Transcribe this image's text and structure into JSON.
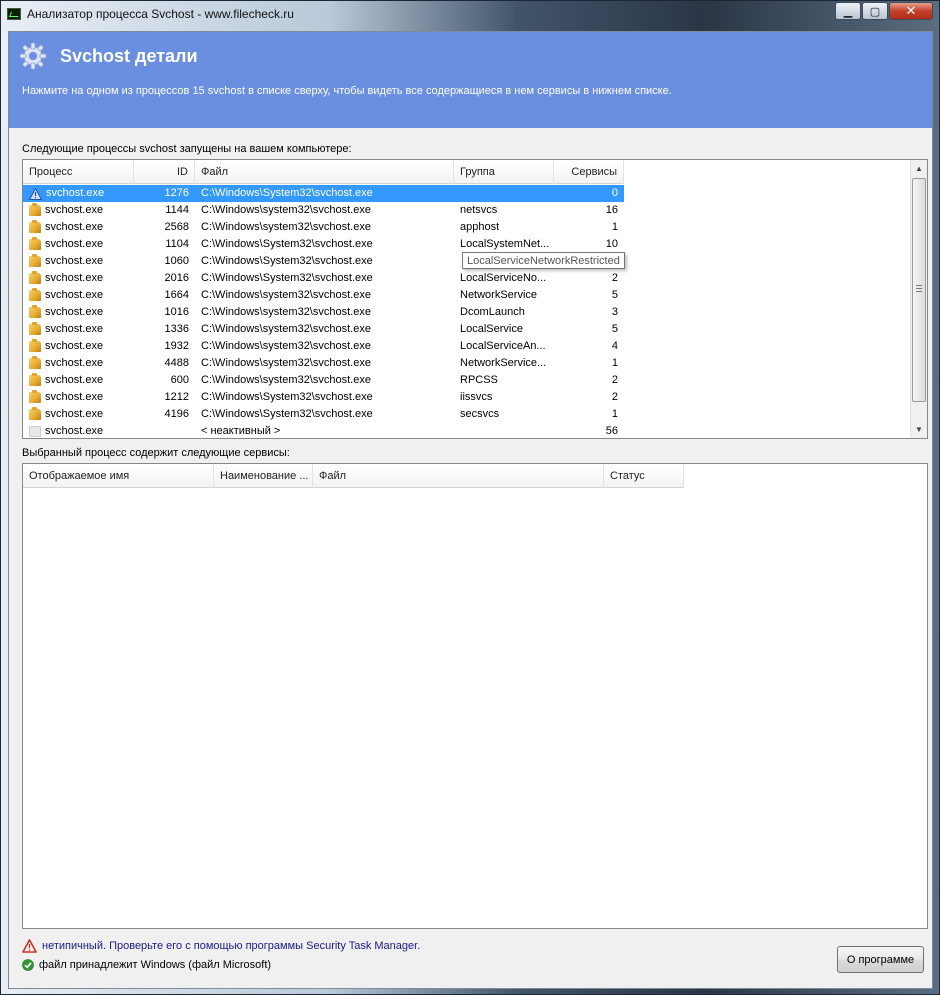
{
  "window": {
    "title": "Анализатор процесса Svchost - www.filecheck.ru",
    "minimize_glyph": "▁",
    "maximize_glyph": "▢",
    "close_glyph": "✕"
  },
  "banner": {
    "title": "Svchost детали",
    "subtitle": "Нажмите на одном из процессов 15 svchost в списке сверху, чтобы видеть все содержащиеся в нем сервисы в нижнем списке.",
    "icon": "gear-icon"
  },
  "processes_section": {
    "label": "Следующие процессы svchost запущены на вашем компьютере:",
    "columns": [
      "Процесс",
      "ID",
      "Файл",
      "Группа",
      "Сервисы"
    ],
    "rows": [
      {
        "process": "svchost.exe",
        "id": "1276",
        "file": "C:\\Windows\\System32\\svchost.exe",
        "group": "",
        "services": "0",
        "icon": "warning-icon",
        "selected": true
      },
      {
        "process": "svchost.exe",
        "id": "1144",
        "file": "C:\\Windows\\system32\\svchost.exe",
        "group": "netsvcs",
        "services": "16",
        "icon": "folder-icon"
      },
      {
        "process": "svchost.exe",
        "id": "2568",
        "file": "C:\\Windows\\system32\\svchost.exe",
        "group": "apphost",
        "services": "1",
        "icon": "folder-icon"
      },
      {
        "process": "svchost.exe",
        "id": "1104",
        "file": "C:\\Windows\\System32\\svchost.exe",
        "group": "LocalSystemNet...",
        "services": "10",
        "icon": "folder-icon"
      },
      {
        "process": "svchost.exe",
        "id": "1060",
        "file": "C:\\Windows\\System32\\svchost.exe",
        "group": "",
        "services": "",
        "icon": "folder-icon"
      },
      {
        "process": "svchost.exe",
        "id": "2016",
        "file": "C:\\Windows\\System32\\svchost.exe",
        "group": "LocalServiceNo...",
        "services": "2",
        "icon": "folder-icon"
      },
      {
        "process": "svchost.exe",
        "id": "1664",
        "file": "C:\\Windows\\system32\\svchost.exe",
        "group": "NetworkService",
        "services": "5",
        "icon": "folder-icon"
      },
      {
        "process": "svchost.exe",
        "id": "1016",
        "file": "C:\\Windows\\system32\\svchost.exe",
        "group": "DcomLaunch",
        "services": "3",
        "icon": "folder-icon"
      },
      {
        "process": "svchost.exe",
        "id": "1336",
        "file": "C:\\Windows\\system32\\svchost.exe",
        "group": "LocalService",
        "services": "5",
        "icon": "folder-icon"
      },
      {
        "process": "svchost.exe",
        "id": "1932",
        "file": "C:\\Windows\\system32\\svchost.exe",
        "group": "LocalServiceAn...",
        "services": "4",
        "icon": "folder-icon"
      },
      {
        "process": "svchost.exe",
        "id": "4488",
        "file": "C:\\Windows\\system32\\svchost.exe",
        "group": "NetworkService...",
        "services": "1",
        "icon": "folder-icon"
      },
      {
        "process": "svchost.exe",
        "id": "600",
        "file": "C:\\Windows\\system32\\svchost.exe",
        "group": "RPCSS",
        "services": "2",
        "icon": "folder-icon"
      },
      {
        "process": "svchost.exe",
        "id": "1212",
        "file": "C:\\Windows\\System32\\svchost.exe",
        "group": "iissvcs",
        "services": "2",
        "icon": "folder-icon"
      },
      {
        "process": "svchost.exe",
        "id": "4196",
        "file": "C:\\Windows\\System32\\svchost.exe",
        "group": "secsvcs",
        "services": "1",
        "icon": "folder-icon"
      },
      {
        "process": "svchost.exe",
        "id": "",
        "file": "< неактивный >",
        "group": "",
        "services": "56",
        "icon": "blank-icon"
      }
    ],
    "tooltip": "LocalServiceNetworkRestricted"
  },
  "services_section": {
    "label": "Выбранный процесс содержит следующие сервисы:",
    "columns": [
      "Отображаемое имя",
      "Наименование ...",
      "Файл",
      "Статус"
    ]
  },
  "footer": {
    "warning_text": "нетипичный. Проверьте его с помощью программы Security Task Manager.",
    "ok_text": "файл принадлежит Windows (файл Microsoft)",
    "about_button": "О программе"
  },
  "colors": {
    "banner": "#6a8fe0",
    "selection": "#3399ff",
    "warning_text": "#1a1a8c"
  }
}
